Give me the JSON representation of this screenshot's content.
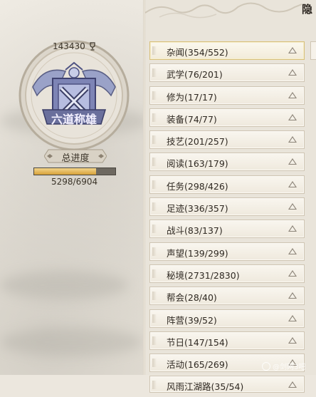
{
  "profile": {
    "score": "143430",
    "medal_title": "六道称雄",
    "progress_label": "总进度",
    "progress_value": "5298/6904",
    "progress_fraction": 0.767
  },
  "corner_char": "隐",
  "categories": [
    {
      "label": "杂闻(354/552)",
      "active": true
    },
    {
      "label": "武学(76/201)"
    },
    {
      "label": "修为(17/17)"
    },
    {
      "label": "装备(74/77)"
    },
    {
      "label": "技艺(201/257)"
    },
    {
      "label": "阅读(163/179)"
    },
    {
      "label": "任务(298/426)"
    },
    {
      "label": "足迹(336/357)"
    },
    {
      "label": "战斗(83/137)"
    },
    {
      "label": "声望(139/299)"
    },
    {
      "label": "秘境(2731/2830)"
    },
    {
      "label": "帮会(28/40)"
    },
    {
      "label": "阵营(39/52)"
    },
    {
      "label": "节日(147/154)"
    },
    {
      "label": "活动(165/269)"
    },
    {
      "label": "风雨江湖路(35/54)"
    }
  ],
  "watermark": "@剑网3吧",
  "colors": {
    "accent_gold": "#d6a13a",
    "text": "#2f2922"
  }
}
